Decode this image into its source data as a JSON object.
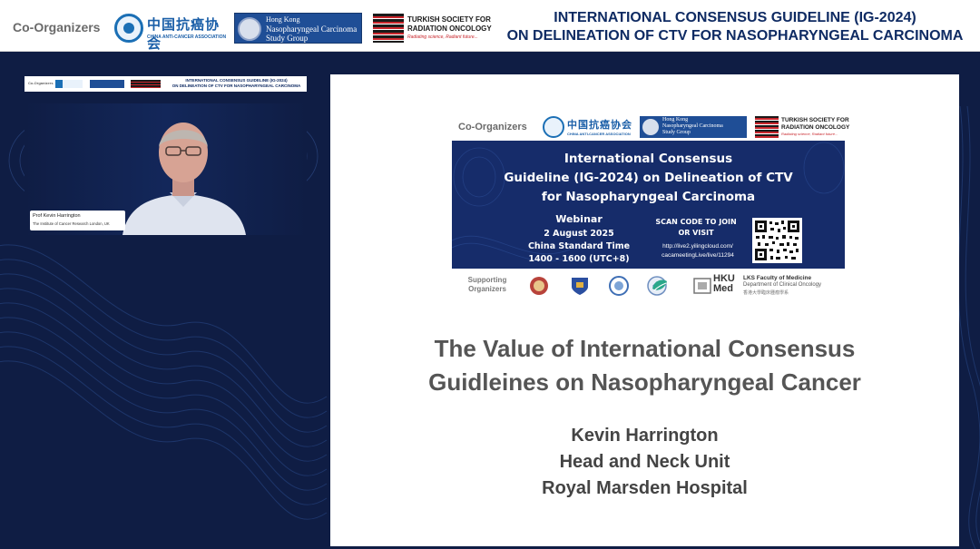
{
  "banner": {
    "co_organizers_label": "Co-Organizers",
    "caca_cn": "中国抗癌协会",
    "caca_en": "CHINA ANTI-CANCER ASSOCIATION",
    "hk_line1": "Hong Kong",
    "hk_line2": "Nasopharyngeal Carcinoma",
    "hk_line3": "Study Group",
    "turkish_line1": "TURKISH SOCIETY FOR",
    "turkish_line2": "RADIATION ONCOLOGY",
    "turkish_tagline": "Radiating science, Radiant future...",
    "title_line1": "INTERNATIONAL CONSENSUS GUIDELINE (IG-2024)",
    "title_line2": "ON DELINEATION OF CTV FOR NASOPHARYNGEAL CARCINOMA"
  },
  "mini_banner": {
    "co_label": "Co-Organizers",
    "title_line1": "INTERNATIONAL CONSENSUS GUIDELINE (IG-2024)",
    "title_line2": "ON DELINEATION OF CTV FOR NASOPHARYNGEAL CARCINOMA"
  },
  "speaker_video": {
    "name": "Prof Kevin Harrington",
    "affiliation": "The Institute of Cancer Research London, UK"
  },
  "slide": {
    "co_organizers_label": "Co-Organizers",
    "poster": {
      "title_line1": "International Consensus",
      "title_line2": "Guideline (IG-2024) on Delineation of CTV",
      "title_line3": "for Nasopharyngeal Carcinoma",
      "event_type": "Webinar",
      "date": "2 August 2025",
      "timezone": "China Standard Time",
      "time": "1400 - 1600 (UTC+8)",
      "scan_line1": "SCAN CODE TO JOIN",
      "scan_line2": "OR VISIT",
      "url_line1": "http://live2.yilingcloud.com/",
      "url_line2": "cacameetingLive/live/11294"
    },
    "supporting": {
      "label_line1": "Supporting",
      "label_line2": "Organizers",
      "hku_line1": "HKU",
      "hku_line2": "Med",
      "lks_line1": "LKS Faculty of Medicine",
      "lks_line2": "Department of Clinical Oncology",
      "lks_line3": "香港大學臨床腫瘤學系"
    },
    "talk_title_line1": "The Value of International Consensus",
    "talk_title_line2": "Guidleines on Nasopharyngeal Cancer",
    "speaker_name": "Kevin Harrington",
    "speaker_unit": "Head and Neck Unit",
    "speaker_hospital": "Royal Marsden Hospital"
  },
  "colors": {
    "background": "#0f1d44",
    "banner_title": "#0f2b63",
    "poster": "#162c6a",
    "talk_title": "#555555"
  },
  "icons": [
    "caca-seal-icon",
    "hk-npc-seal-icon",
    "turkish-flag-icon",
    "qr-code-icon",
    "supporter-badge-icon"
  ]
}
